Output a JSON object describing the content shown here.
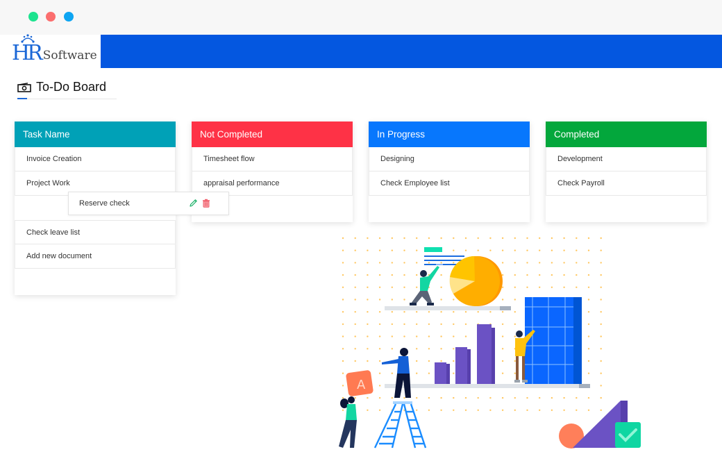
{
  "window": {
    "controls": [
      "close",
      "minimize",
      "maximize"
    ]
  },
  "header": {
    "logo_mark": "HR",
    "logo_text": "Software",
    "accent_color": "#0457e0"
  },
  "page": {
    "title": "To-Do Board",
    "title_icon": "money-bill-icon"
  },
  "board": {
    "columns": [
      {
        "label": "Task Name",
        "color": "#00a1b7",
        "items": [
          "Invoice Creation",
          "Project Work",
          "",
          "Check leave list",
          "Add new document"
        ]
      },
      {
        "label": "Not Completed",
        "color": "#fe3246",
        "items": [
          "Timesheet flow",
          "appraisal performance"
        ]
      },
      {
        "label": "In Progress",
        "color": "#0777fd",
        "items": [
          "Designing",
          "Check Employee list"
        ]
      },
      {
        "label": "Completed",
        "color": "#03a73c",
        "items": [
          "Development",
          "Check Payroll"
        ]
      }
    ],
    "dragging_card": {
      "label": "Reserve check",
      "edit_icon": "pencil-icon",
      "delete_icon": "trash-icon"
    }
  },
  "illustration": {
    "description": "team-analytics-illustration"
  }
}
